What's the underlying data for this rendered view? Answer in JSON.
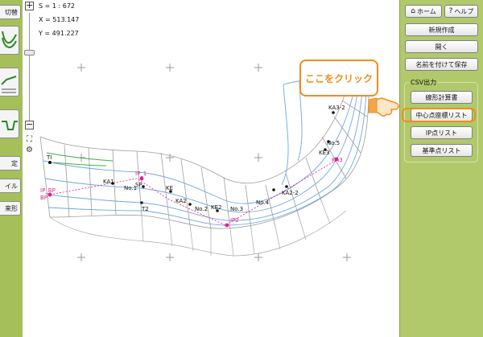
{
  "readouts": {
    "scale": "S = 1 : 672",
    "x": "X = 513.147",
    "y": "Y = 491.227"
  },
  "left_toolbar": {
    "cut_label": "切替",
    "fix_label": "定",
    "file_label": "イル",
    "shape_label": "来形"
  },
  "callout": {
    "text": "ここをクリック"
  },
  "right_panel": {
    "home_label": "ホーム",
    "help_label": "ヘルプ",
    "new_label": "新規作成",
    "open_label": "開く",
    "save_as_label": "名前を付けて保存",
    "csv_group_label": "CSV出力",
    "alignment_calc_label": "線形計算書",
    "center_coord_label": "中心点座標リスト",
    "ip_list_label": "IP点リスト",
    "ref_point_list_label": "基準点リスト"
  },
  "map": {
    "point_labels": [
      "KA3-2",
      "No.5",
      "KE3",
      "KA3",
      "TI",
      "IP_BP",
      "BP",
      "IP_1",
      "KA1",
      "SP",
      "T2",
      "KE",
      "KA2",
      "IP2",
      "KE2",
      "No.3",
      "No.4",
      "KA2-2",
      "No.2",
      "No.1"
    ],
    "colors": {
      "road_line": "#6fa8dc",
      "grid_line": "#9e9e9e",
      "ip_line": "#e0208c",
      "green_line": "#3cb043"
    }
  }
}
